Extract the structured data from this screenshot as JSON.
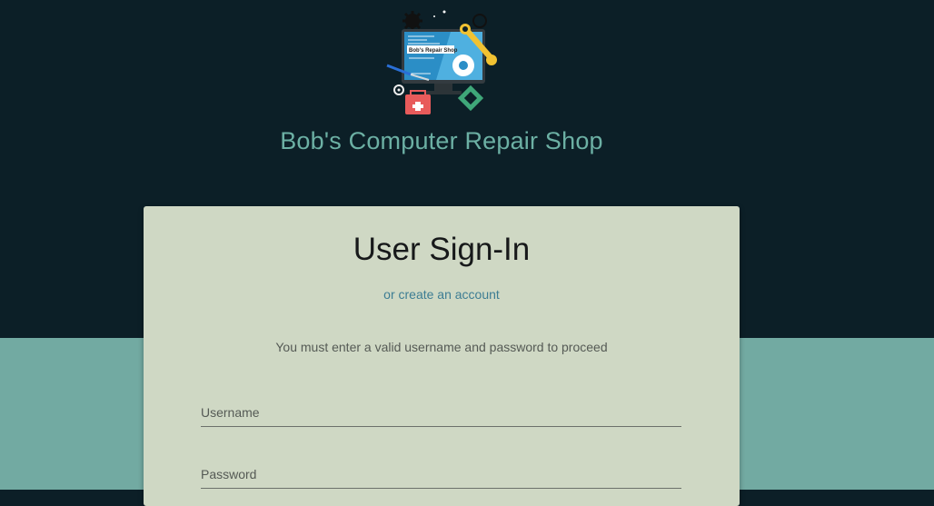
{
  "header": {
    "shop_name": "Bob's Computer Repair Shop",
    "logo_text": "Bob's Repair Shop",
    "logo_icon": "computer-repair-logo"
  },
  "signin": {
    "title": "User Sign-In",
    "create_account_link": "or create an account",
    "instructions": "You must enter a valid username and password to proceed",
    "username_placeholder": "Username",
    "username_value": "",
    "password_placeholder": "Password",
    "password_value": ""
  },
  "colors": {
    "header_background": "#0c1f27",
    "lower_background": "#72aaa2",
    "card_background": "#cfd8c4",
    "title_teal": "#6cb0a4",
    "link_blue": "#3d7d93"
  }
}
